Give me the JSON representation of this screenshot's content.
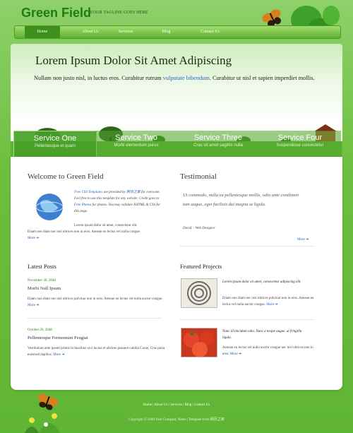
{
  "header": {
    "site_title": "Green Field",
    "tagline": "YOUR TAGLINE GOES HERE"
  },
  "nav": [
    "Home",
    "About Us",
    "Services",
    "Blog",
    "Contact Us"
  ],
  "hero": {
    "title": "Lorem Ipsum Dolor Sit Amet Adipiscing",
    "text_before": "Nullam non justo nisl, in luctus eros. Curabitur rutrum ",
    "link": "vulputate bibendum",
    "text_after": ". Curabitur ut nisl et sapien imperdiet mollis."
  },
  "services": [
    {
      "title": "Service One",
      "subtitle": "Pellentesque et quam"
    },
    {
      "title": "Service Two",
      "subtitle": "Morbi elementum purus"
    },
    {
      "title": "Service Three",
      "subtitle": "Cras sit amet sagittis nulla"
    },
    {
      "title": "Service Four",
      "subtitle": "Suspendisse consectetur"
    }
  ],
  "welcome": {
    "heading": "Welcome to Green Field",
    "intro_link1": "Free CSS Templates",
    "intro_1": " are provided by ",
    "intro_link2": "网页之家",
    "intro_2": " for everyone. Feel free to use this template for any website. Credit goes to ",
    "intro_link3": "Free Photos",
    "intro_3": " for photos. You may validate XHTML & CSS for this page.",
    "body_1": "Lorem ipsum dolor sit amet, consectetur elit.",
    "body_2": "Etiam non diam nec nisl ultrices non in eros. Aenean eu lectus vel nulla congue.",
    "more": "More ➔"
  },
  "testimonial": {
    "heading": "Testimonial",
    "quote": "Ut commodo, nulla eu pellentesque mollis, odio ante condimen tum augue, eget facilisis dui magna ut ligula.",
    "author": "David. - Web Designer",
    "more": "More ➔"
  },
  "latest_posts": {
    "heading": "Latest Posts",
    "posts": [
      {
        "date": "November 30, 2048",
        "title": "Morbi Null Ipsum",
        "body": "Etiam non diam nec nisl ultrices pulvinar non in eros. Aenean eu lectus vel nulla auctor congue.",
        "more": "More ➔"
      },
      {
        "date": "October 26, 2048",
        "title": "Pellentesque Fermentum Feugiat",
        "body": "Vestibulum ante ipsum primis in faucibus orci luctus et ultrices posuere cubilia Curae; Cras porta euismod dapibus.",
        "more": "More ➔"
      }
    ]
  },
  "featured_projects": {
    "heading": "Featured Projects",
    "projects": [
      {
        "caption": "Lorem ipsum dolor sit amet, consectetur adipiscing elit.",
        "body": "Etiam non diam nec nisl ultrices pulvinar non in eros. Aenean eu lectus vel nulla auctor congue.",
        "more": "More ➔"
      },
      {
        "caption": "Nunc id tincidunt odio. Nunc a neque augue, ut fringilla ligula.",
        "body": "Aenean eu lectus vel nulla auctor congue nec nisl ultrices non in eros.",
        "more": "More ➔"
      }
    ]
  },
  "footer": {
    "links": "Home | About Us | Services | Blog | Contact Us",
    "copyright": "Copyright © 2048 Your Company Name | Template from 网页之家"
  },
  "colors": {
    "brand_green": "#1d7d10",
    "link_blue": "#1f5fbf"
  }
}
